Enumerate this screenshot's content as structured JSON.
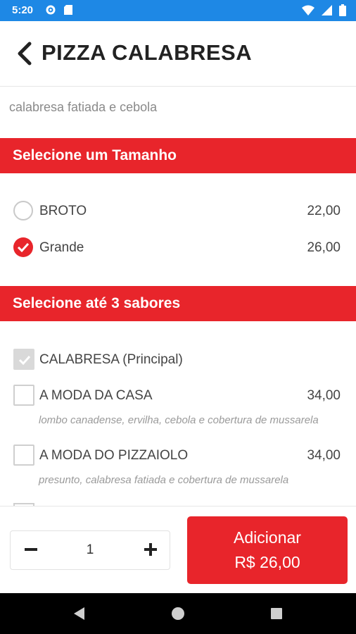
{
  "status_bar": {
    "time": "5:20"
  },
  "header": {
    "title": "PIZZA CALABRESA"
  },
  "description": "calabresa fatiada e cebola",
  "size_section": {
    "title": "Selecione um Tamanho",
    "options": [
      {
        "label": "BROTO",
        "price": "22,00",
        "selected": false
      },
      {
        "label": "Grande",
        "price": "26,00",
        "selected": true
      }
    ]
  },
  "flavor_section": {
    "title": "Selecione até 3 sabores",
    "items": [
      {
        "label": "CALABRESA (Principal)",
        "price": "",
        "description": "",
        "checked": true,
        "disabled": true
      },
      {
        "label": "A MODA DA CASA",
        "price": "34,00",
        "description": "lombo canadense, ervilha, cebola e cobertura de mussarela",
        "checked": false
      },
      {
        "label": "A MODA DO PIZZAIOLO",
        "price": "34,00",
        "description": "presunto, calabresa fatiada e cobertura de mussarela",
        "checked": false
      }
    ]
  },
  "footer": {
    "quantity": "1",
    "add_label": "Adicionar",
    "add_price": "R$ 26,00"
  },
  "colors": {
    "accent": "#e8252b",
    "status_bar": "#1e88e5"
  }
}
